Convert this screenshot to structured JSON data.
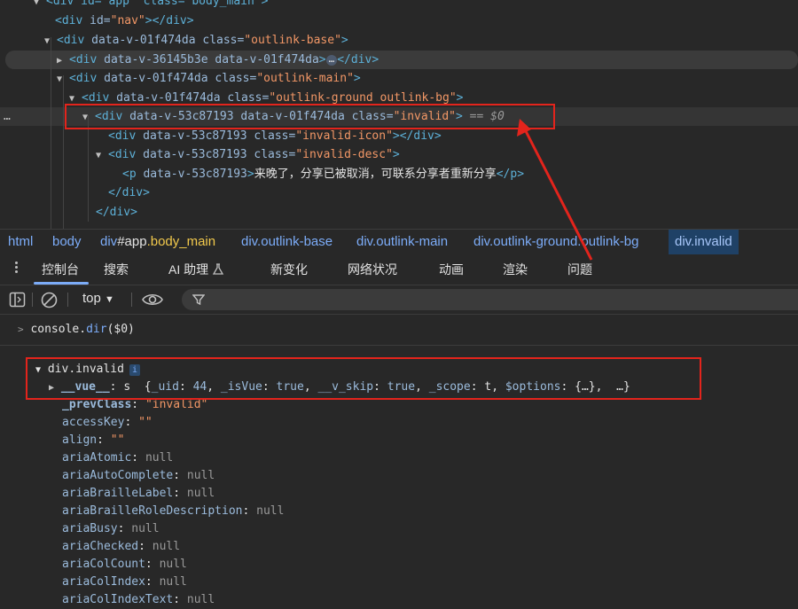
{
  "elements": {
    "lines": [
      {
        "pre": "<div id=\"app\" class=\"body_main\">"
      },
      {
        "open": "<div",
        "attrs": " id=",
        "v": "\"nav\"",
        "close": "></div>"
      }
    ],
    "line0": "<div id=\"app\" class=\"body_main\">",
    "nav_tag": "<div ",
    "nav_attr": "id=",
    "nav_val": "\"nav\"",
    "nav_close": "></div>",
    "base_attr": "data-v-01f474da class=",
    "base_val": "\"outlink-base\"",
    "child_attrs": "data-v-36145b3e data-v-01f474da",
    "main_attr": "data-v-01f474da class=",
    "main_val": "\"outlink-main\"",
    "ground_attr": "data-v-01f474da class=",
    "ground_val": "\"outlink-ground outlink-bg\"",
    "invalid_attr": "data-v-53c87193 data-v-01f474da class=",
    "invalid_val": "\"invalid\"",
    "eq_dollar0": "== $0",
    "icon_attr": "data-v-53c87193 class=",
    "icon_val": "\"invalid-icon\"",
    "desc_attr": "data-v-53c87193 class=",
    "desc_val": "\"invalid-desc\"",
    "p_attr": "data-v-53c87193",
    "p_text": "来晚了，分享已被取消，可联系分享者重新分享",
    "close_div": "</div>",
    "ellipsis": "…",
    "row_menu": "…"
  },
  "breadcrumb": {
    "html": "html",
    "body": "body",
    "app_tag": "div",
    "app_id": "#app",
    "app_class": ".body_main",
    "base": "div.outlink-base",
    "main": "div.outlink-main",
    "ground": "div.outlink-ground.outlink-bg",
    "invalid": "div.invalid"
  },
  "drawer_tabs": [
    "控制台",
    "搜索",
    "AI 助理",
    "新变化",
    "网络状况",
    "动画",
    "渲染",
    "问题"
  ],
  "console_toolbar": {
    "context": "top",
    "context_arrow": "▼"
  },
  "console": {
    "input": "console.dir($0)",
    "input_prefix": "console.",
    "input_method": "dir",
    "input_args": "($0)",
    "object_name": "div.invalid",
    "info_badge": "i",
    "vue_key": "__vue__",
    "vue_type": "s",
    "vue_preview": {
      "uid_key": "_uid",
      "uid_val": "44",
      "isvue_key": "_isVue",
      "isvue_val": "true",
      "vskip_key": "__v_skip",
      "vskip_val": "true",
      "scope_key": "_scope",
      "scope_val": "t",
      "options_key": "$options",
      "options_val": "{…}",
      "more": "…"
    },
    "prevclass_key": "_prevClass",
    "prevclass_val": "\"invalid\"",
    "props": [
      {
        "key": "accessKey",
        "val": "\"\"",
        "kind": "str"
      },
      {
        "key": "align",
        "val": "\"\"",
        "kind": "str"
      },
      {
        "key": "ariaAtomic",
        "val": "null",
        "kind": "null"
      },
      {
        "key": "ariaAutoComplete",
        "val": "null",
        "kind": "null"
      },
      {
        "key": "ariaBrailleLabel",
        "val": "null",
        "kind": "null"
      },
      {
        "key": "ariaBrailleRoleDescription",
        "val": "null",
        "kind": "null"
      },
      {
        "key": "ariaBusy",
        "val": "null",
        "kind": "null"
      },
      {
        "key": "ariaChecked",
        "val": "null",
        "kind": "null"
      },
      {
        "key": "ariaColCount",
        "val": "null",
        "kind": "null"
      },
      {
        "key": "ariaColIndex",
        "val": "null",
        "kind": "null"
      },
      {
        "key": "ariaColIndexText",
        "val": "null",
        "kind": "null"
      }
    ]
  },
  "colors": {
    "annotation_red": "#e3241c",
    "tag_blue": "#5db0d7",
    "attr_value_orange": "#f29766",
    "active_tab_underline": "#7cacf8"
  }
}
